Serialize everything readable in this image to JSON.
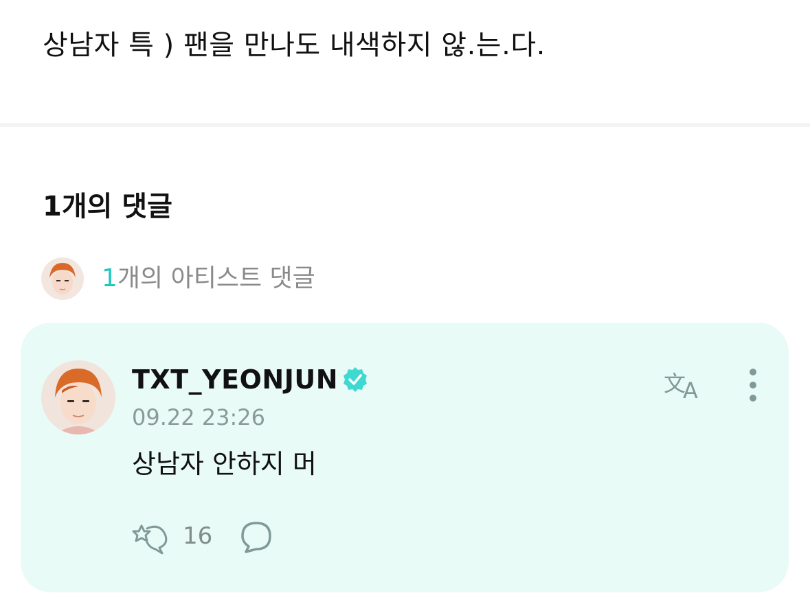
{
  "post": {
    "text": "상남자 특 ) 팬을 만나도 내색하지 않.는.다."
  },
  "comments": {
    "count_label": "1개의 댓글",
    "artist_summary": {
      "count": "1",
      "label": "개의 아티스트 댓글"
    }
  },
  "comment": {
    "username": "TXT_YEONJUN",
    "timestamp": "09.22 23:26",
    "body": "상남자 안하지 머",
    "reaction_count": "16"
  },
  "colors": {
    "accent": "#1ec7c0",
    "card_bg": "#e9fbf7",
    "verified": "#3fd9d2",
    "icon_gray": "#7f9a97"
  },
  "icons": {
    "verified": "verified-badge-icon",
    "translate": "translate-icon",
    "more": "more-vertical-icon",
    "reaction": "reaction-icon",
    "reply": "reply-bubble-icon"
  }
}
